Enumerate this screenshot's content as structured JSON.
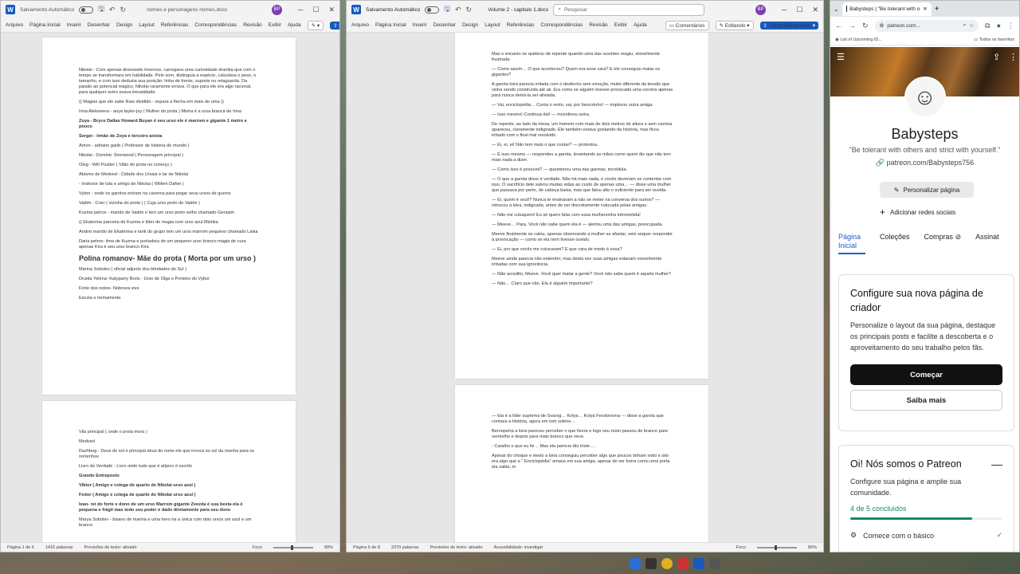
{
  "word1": {
    "autosave": "Salvamento Automático",
    "filename": "nomes e personagens nomes.docx",
    "avatar": "BP",
    "menu": [
      "Arquivo",
      "Página Inicial",
      "Inserir",
      "Desenhar",
      "Design",
      "Layout",
      "Referências",
      "Correspondências",
      "Revisão",
      "Exibir",
      "Ajuda"
    ],
    "page1": [
      {
        "t": "Nikolai - Com apenas dezessete invernos, carregava uma curiosidade doentia que com o tempo se transformara em habilidade. Pelo som, distinguia a espécie, calculava o peso, o tamanho, e com isso deduzia sua posição: linha de frente, suporte ou retaguarda. Da paixão ao potencial mágico, Nikolai raramente errava. O que para ele era algo racional, para qualquer outro soava inexatidade.",
        "s": ""
      },
      {
        "t": "(( Magias que ele sabe Raio dividido - separa a flecha em mais de uma ))",
        "s": ""
      },
      {
        "t": "Irina Alekseeva - anya taylor-joy ( Mulher do prota ) Misha é a ursa branca de Irina",
        "s": ""
      },
      {
        "t": "Zoya - Bryce Dallas Howard Buyan é seu urso ele é marrom e gigante 1 metro e pouco",
        "s": "b"
      },
      {
        "t": "Sergei - irmão de Zoya e terceiro anista",
        "s": "b"
      },
      {
        "t": "Amon - adriano garib ( Professor de historia do mundo )",
        "s": ""
      },
      {
        "t": "Nikolai - Dominic Sherwood ( Personagem principal )",
        "s": ""
      },
      {
        "t": "Oleg - Will Poulter ( Vilão do prota no começo )",
        "s": ""
      },
      {
        "t": "Abismo de Medved - Cidade dos Ursais e lar de Nikolai",
        "s": ""
      },
      {
        "t": "- Instrutor de luta e amigo de Nikolai ( Willem Dafoe )",
        "s": ""
      },
      {
        "t": "Vybor - onde os garotos entram na caverna para pegar seus ursos de guerra",
        "s": ""
      },
      {
        "t": "Vadim - Crier ( vizinha do prota ) ( Cuja urso preto de Vadim )",
        "s": ""
      },
      {
        "t": "Kuzma petrov - marido de Vadim e tem um urso preto velho chamado Gerasim",
        "s": ""
      },
      {
        "t": "(( Ekaterina parceira de Kuzma e líder de magia com urso azul Mishka",
        "s": ""
      },
      {
        "t": "Andrei marido de Ekaterina e tank do grupo tem um urso marrom pequeno chamado Laika",
        "s": ""
      },
      {
        "t": "Daria petrov- ilma de Kuzma e portadora de um pequeno urso branco magia de cura apenas Kira é seu urso branco Kira",
        "s": ""
      },
      {
        "t": "Polina romanov- Mãe do prota ( Morta por um urso )",
        "s": "big"
      },
      {
        "t": "Marina Sobolev ( oficial adjunto dos blindados do Sul )",
        "s": ""
      },
      {
        "t": "Druida Yelena- Katyparry Boris - Urso de Olga e Porteiro do Vybor",
        "s": ""
      },
      {
        "t": "Forte dos nobre- Nobreza vive",
        "s": ""
      },
      {
        "t": "Escola e treinamento",
        "s": ""
      }
    ],
    "page2": [
      {
        "t": "Vila principal ( onde o prota mora )",
        "s": ""
      },
      {
        "t": "Medved",
        "s": ""
      },
      {
        "t": "Dazhbog - Deus do sol e principal deus do norte ele que invoca os sol da manha para os nortenhos",
        "s": ""
      },
      {
        "t": "Livro da Verdade - Livro onde tudo que é atípico é escrito",
        "s": ""
      },
      {
        "t": "Grande Entreposto",
        "s": "b"
      },
      {
        "t": "Viktor ( Amigo e colega de quarto de Nikolai urso azul )",
        "s": "b"
      },
      {
        "t": "Fedor ( Amigo e colega de quarto do Nikolai urso azul )",
        "s": "b"
      },
      {
        "t": "Ivan- rei do forte e dono de um urso Marrom gigante Zvezda é sua besta ela é pequena e frágil mas todo seu poder é dado diretamente para seu dono",
        "s": "b"
      },
      {
        "t": "Marya Sobolev - bisavo de marina e uma hero na a única com dois ursos um azul e um branco",
        "s": ""
      }
    ],
    "status": {
      "page": "Página 1 de 6",
      "words": "1416 palavras",
      "predict": "Previsões de texto: ativado",
      "focus": "Foco",
      "zoom": "80%"
    }
  },
  "word2": {
    "autosave": "Salvamento Automático",
    "filename": "Volume 2 - capitulo 1.docx",
    "search": "Pesquisar",
    "avatar": "BP",
    "menu": [
      "Arquivo",
      "Página Inicial",
      "Inserir",
      "Desenhar",
      "Design",
      "Layout",
      "Referências",
      "Correspondências",
      "Revisão",
      "Exibir",
      "Ajuda"
    ],
    "comments": "Comentários",
    "editing": "Editando",
    "share": "Compartilhamento",
    "page1": [
      "Mas o encanto se quebrou de repente quando uma das ouvintes reagiu, visivelmente frustrada:",
      "— Como assim… O que aconteceu? Quem era esse cara? E ele conseguiu matar os gigantes?",
      "A garota loira parecia irritada com o desfecho sem emoção, muito diferente da tensão que vinha sendo construída até ali. Era como se alguém tivesse provocado uma coceira apenas para nunca deixá-la ser aliviada.",
      "— Vai, enciclopédia… Conta o resto, vai, por favorzinho! — implorou outra amiga.",
      "— Isso mesmo! Continua daí! — incentivou outra.",
      "De repente, ao lado da mesa, um homem com mais de dois metros de altura e sem camisa apareceu, claramente indignado. Ele também estava gostando da história, mas ficou irritado com o final mal resolvido.",
      "— Ei, ei, ei! Não tem mais o que contar? — protestou.",
      "— É isso mesmo — respondeu a garota, levantando as mãos como quem diz que não tem mais nada a dizer.",
      "— Como isso é possível? — questionou uma das garotas, incrédula.",
      "— O que a garota disse é verdade. Não há mais nada, e vocês deveriam se contentar com isso. O sacrifício dele salvou muitas vidas ao custo de apenas uma… — disse uma mulher que passava por perto, de cabeça baixa, mas que falou alto o suficiente para ser ouvida.",
      "— Ei, quem é você? Nunca te ensinaram a não se meter na conversa dos outros? — retrucou a loira, indignada, antes de ser discretamente cutucada pelas amigas.",
      "— Não me cutuquem! Eu só quero falar com essa mulherzinha intrometida!",
      "— Meeve… Para. Você não sabe quem ela é — alertou uma das amigas, preocupada.",
      "Meeve finalmente se calou, apenas observando a mulher se afastar, sem sequer responder à provocação — como se ela nem tivesse ouvido.",
      "— Ei, por que vocês me cutucaram? E que cara de medo é essa?",
      "Meeve ainda parecia não entender, mas desta vez suas amigas estavam visivelmente irritadas com sua ignorância.",
      "— Não acredito, Meeve. Você quer matar a gente? Você não sabe quem é aquela mulher?",
      "— Não… Claro que não. Ela é alguém importante?"
    ],
    "page2": [
      "— Ela é a líder suprema de Svarog… Kolya… Kolya Feodorovna — disse a garota que contava a história, agora em tom solene…",
      "Bernoperta a loira pareceu perceber o que fizera e logo seu rosto passou de branco para vermelho e depois para mais branco que neve.",
      "- Caralho o que eu fiz… Mas ela parecia tão triste….",
      "Apesar do choque e medo a loira conseguiu perceber algo que poucos tinham visto e isto era algo que a \" Enciclopédia\" amava em sua amiga, apesar de ser burra como uma porta ela sabia, m"
    ],
    "status": {
      "page": "Página 6 de 8",
      "words": "2379 palavras",
      "predict": "Previsões de texto: ativado",
      "access": "Acessibilidade: investigar",
      "focus": "Foco",
      "zoom": "80%"
    }
  },
  "browser": {
    "tab_title": "Babysteps | \"Be tolerant with o",
    "url": "patreon.com...",
    "bookmark1": "List of Upcoming ID...",
    "bookmark2": "Todos os favoritos",
    "profile_name": "Babysteps",
    "quote": "\"Be tolerant with others and strict with yourself.\"",
    "link": "patreon.com/Babysteps756",
    "personalize": "Personalizar página",
    "add_social": "Adicionar redes sociais",
    "nav": [
      "Página Inicial",
      "Coleções",
      "Compras",
      "Assinat"
    ],
    "card1": {
      "title": "Configure sua nova página de criador",
      "body": "Personalize o layout da sua página, destaque os principais posts e facilite a descoberta e o aproveitamento do seu trabalho pelos fãs.",
      "primary": "Começar",
      "secondary": "Saiba mais"
    },
    "card2": {
      "title": "Oi! Nós somos o Patreon",
      "body": "Configure sua página e amplie sua comunidade.",
      "progress": "4 de 5 concluídos",
      "progress_value": 0.8,
      "step": "Comece com o básico"
    }
  }
}
